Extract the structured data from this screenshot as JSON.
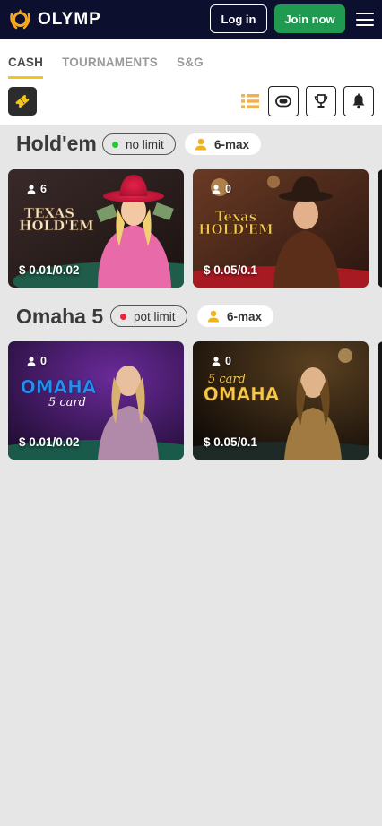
{
  "header": {
    "brand": "OLYMP",
    "login_label": "Log in",
    "join_label": "Join now",
    "colors": {
      "bar": "#0c0f2e",
      "join": "#1f9a50",
      "logo": "#f5a623"
    }
  },
  "tabs": [
    {
      "label": "CASH",
      "active": true
    },
    {
      "label": "TOURNAMENTS",
      "active": false
    },
    {
      "label": "S&G",
      "active": false
    }
  ],
  "toolbar": {
    "icons": [
      "ticket-icon",
      "list-view-icon",
      "chip-icon",
      "trophy-icon",
      "bell-icon"
    ]
  },
  "sections": [
    {
      "title": "Hold'em",
      "limit": {
        "label": "no limit",
        "dot_color": "#22cc33"
      },
      "max": {
        "label": "6-max"
      },
      "tables": [
        {
          "players": "6",
          "stakes": "$ 0.01/0.02",
          "art_title": "TEXAS HOLD'EM"
        },
        {
          "players": "0",
          "stakes": "$ 0.05/0.1",
          "art_title": "TEXAS HOLD'EM"
        }
      ]
    },
    {
      "title": "Omaha 5",
      "limit": {
        "label": "pot limit",
        "dot_color": "#e8233a"
      },
      "max": {
        "label": "6-max"
      },
      "tables": [
        {
          "players": "0",
          "stakes": "$ 0.01/0.02",
          "art_title": "OMAHA",
          "art_sub": "5 card"
        },
        {
          "players": "0",
          "stakes": "$ 0.05/0.1",
          "art_title": "OMAHA",
          "art_sub": "5 card"
        }
      ]
    }
  ]
}
